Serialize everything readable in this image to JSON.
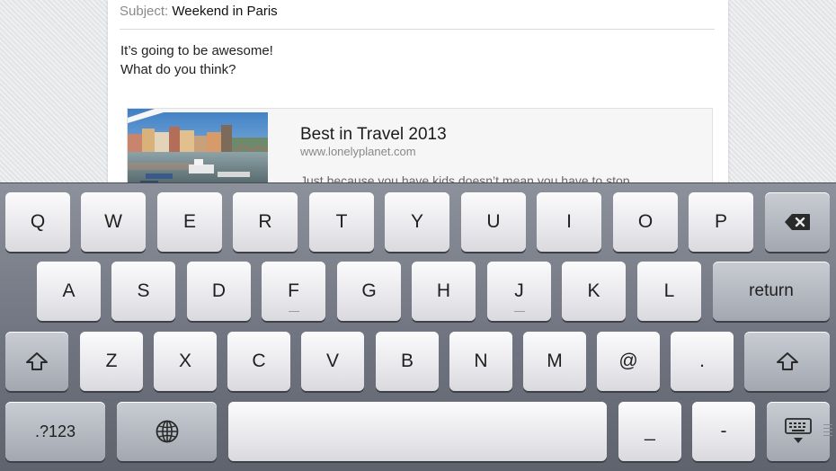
{
  "email": {
    "subject_label": "Subject:",
    "subject_value": "Weekend in Paris",
    "body_lines": [
      "It’s going to be awesome!",
      "What do you think?"
    ],
    "link_card": {
      "title": "Best in Travel 2013",
      "url": "www.lonelyplanet.com",
      "description": "Just because you have kids doesn’t mean you have to stop"
    }
  },
  "keyboard": {
    "row1": [
      "Q",
      "W",
      "E",
      "R",
      "T",
      "Y",
      "U",
      "I",
      "O",
      "P"
    ],
    "row2": [
      "A",
      "S",
      "D",
      "F",
      "G",
      "H",
      "J",
      "K",
      "L"
    ],
    "row3": [
      "Z",
      "X",
      "C",
      "V",
      "B",
      "N",
      "M",
      "@",
      "."
    ],
    "return_label": "return",
    "numbers_label": ".?123",
    "underscore_label": "_",
    "dash_label": "-",
    "icons": {
      "delete": "backspace-icon",
      "shift": "shift-arrow-icon",
      "globe": "globe-icon",
      "hide": "keyboard-dismiss-icon"
    }
  }
}
